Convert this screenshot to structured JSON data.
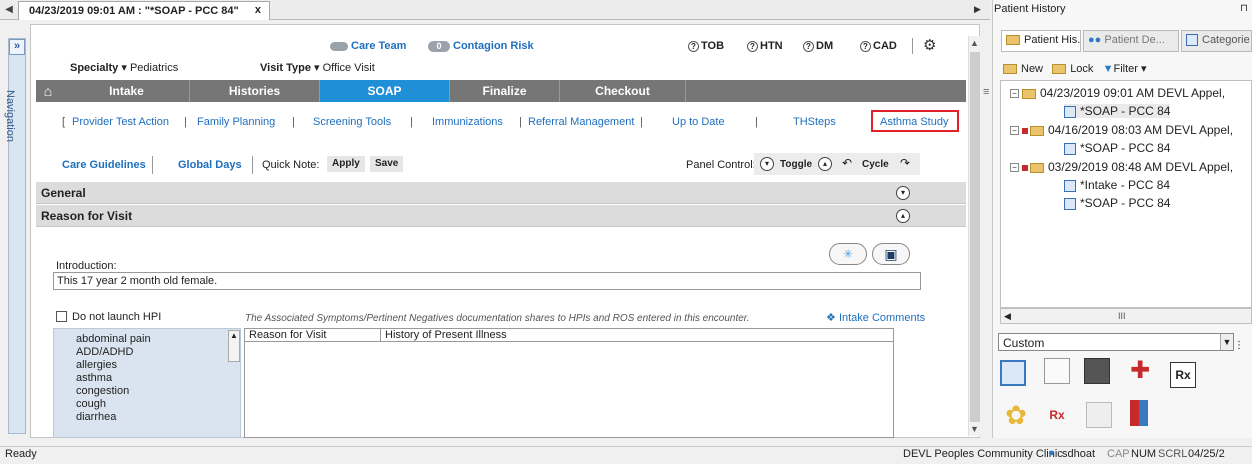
{
  "tab": {
    "title": "04/23/2019 09:01 AM : \"*SOAP - PCC 84\"",
    "close": "x"
  },
  "navigation_label": "Navigation",
  "header": {
    "specialty_label": "Specialty ▾",
    "specialty_value": "Pediatrics",
    "visit_type_label": "Visit Type ▾",
    "visit_type_value": "Office Visit",
    "care_team": "Care Team",
    "contagion_count": "0",
    "contagion": "Contagion Risk",
    "flags": [
      "TOB",
      "HTN",
      "DM",
      "CAD"
    ]
  },
  "nav_tabs": [
    "Intake",
    "Histories",
    "SOAP",
    "Finalize",
    "Checkout"
  ],
  "action_links": [
    "Provider Test Action",
    "Family Planning",
    "Screening Tools",
    "Immunizations",
    "Referral Management",
    "Up to Date",
    "THSteps",
    "Asthma Study"
  ],
  "toolbar": {
    "care_guidelines": "Care Guidelines",
    "global_days": "Global Days",
    "quick_note": "Quick Note:",
    "apply": "Apply",
    "save": "Save",
    "panel_control": "Panel Control:",
    "toggle": "Toggle",
    "cycle": "Cycle"
  },
  "sections": {
    "general": "General",
    "reason_for_visit": "Reason for Visit"
  },
  "intro": {
    "label": "Introduction:",
    "value": "This 17 year 2 month old female."
  },
  "hpi": {
    "checkbox_label": "Do not launch HPI",
    "note": "The Associated Symptoms/Pertinent Negatives documentation shares to HPIs and ROS entered in this encounter.",
    "intake_comments": "Intake Comments",
    "complaints": [
      "abdominal pain",
      "ADD/ADHD",
      "allergies",
      "asthma",
      "congestion",
      "cough",
      "diarrhea"
    ],
    "col_reason": "Reason for Visit",
    "col_history": "History of Present Illness"
  },
  "right_panel": {
    "title": "Patient History",
    "pin": "⊓",
    "tabs": [
      "Patient His...",
      "Patient De...",
      "Categorie"
    ],
    "toolbar": {
      "new": "New",
      "lock": "Lock",
      "filter": "Filter ▾"
    },
    "tree": [
      {
        "label": "04/23/2019 09:01 AM  DEVL Appel,",
        "children": [
          "*SOAP - PCC 84"
        ]
      },
      {
        "label": "04/16/2019 08:03 AM  DEVL Appel,",
        "children": [
          "*SOAP - PCC 84"
        ]
      },
      {
        "label": "03/29/2019 08:48 AM  DEVL Appel,",
        "children": [
          "*Intake - PCC 84",
          "*SOAP - PCC 84"
        ]
      }
    ],
    "scroll_mark": "III",
    "custom_select": "Custom"
  },
  "status": {
    "ready": "Ready",
    "clinic": "DEVL Peoples Community Clinic",
    "user": "sdhoat",
    "cap": "CAP",
    "num": "NUM",
    "scrl": "SCRL",
    "date": "04/25/2"
  },
  "colors": {
    "accent_blue": "#1f6fbf",
    "soap_tab": "#1f8fd8",
    "nav_gray": "#767676",
    "highlight_red": "#e0202a"
  }
}
